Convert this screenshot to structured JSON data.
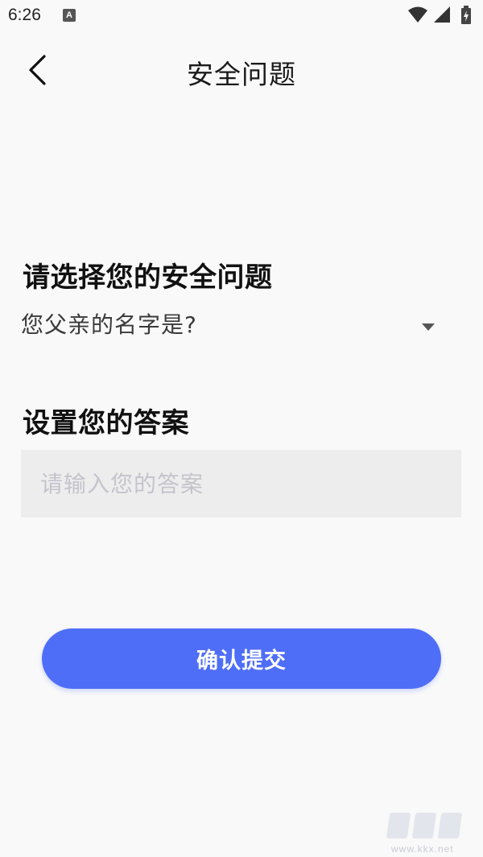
{
  "status_bar": {
    "time": "6:26",
    "notification_glyph": "A",
    "icons": [
      "wifi-icon",
      "signal-icon",
      "battery-charging-icon"
    ]
  },
  "header": {
    "back_icon": "chevron-left-icon",
    "title": "安全问题"
  },
  "question_section": {
    "title": "请选择您的安全问题",
    "selected_question": "您父亲的名字是?",
    "dropdown_icon": "caret-down-icon"
  },
  "answer_section": {
    "title": "设置您的答案",
    "input_value": "",
    "input_placeholder": "请输入您的答案"
  },
  "submit": {
    "label": "确认提交"
  },
  "watermark": {
    "url": "www.kkx.net"
  },
  "colors": {
    "background": "#f9f9fa",
    "accent": "#4f6ef7",
    "input_background": "#eeedee",
    "placeholder": "#c4c4cc"
  }
}
